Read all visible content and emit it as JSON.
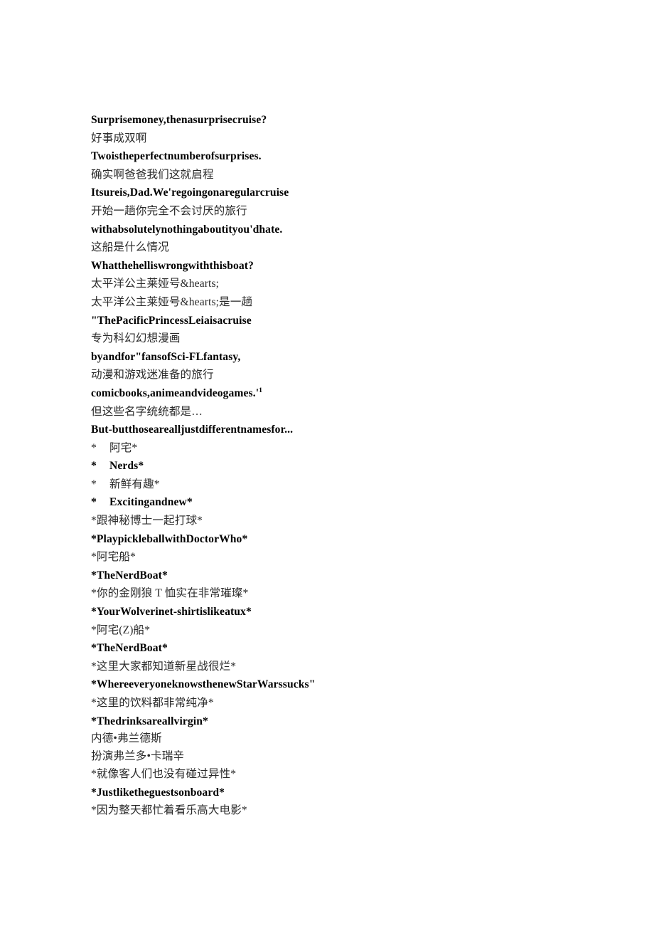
{
  "document": {
    "background_color": "#ffffff",
    "text_color": "#111111",
    "lines": [
      {
        "id": "l1",
        "text": "Surprisemoney,thenasurprisecruise?",
        "script": "latin",
        "style": "plain"
      },
      {
        "id": "l2",
        "text": "好事成双啊",
        "script": "cjk",
        "style": "plain"
      },
      {
        "id": "l3",
        "text": "Twoistheperfectnumberofsurprises.",
        "script": "latin",
        "style": "plain"
      },
      {
        "id": "l4",
        "text": "确实啊爸爸我们这就启程",
        "script": "cjk",
        "style": "plain"
      },
      {
        "id": "l5",
        "text": "Itsureis,Dad.We'regoingonaregularcruise",
        "script": "latin",
        "style": "plain"
      },
      {
        "id": "l6",
        "text": "开始一趟你完全不会讨厌的旅行",
        "script": "cjk",
        "style": "plain"
      },
      {
        "id": "l7",
        "text": "withabsolutelynothingaboutityou'dhate.",
        "script": "latin",
        "style": "plain"
      },
      {
        "id": "l8",
        "text": "这船是什么情况",
        "script": "cjk",
        "style": "plain"
      },
      {
        "id": "l9",
        "text": "Whatthehelliswrongwiththisboat?",
        "script": "latin",
        "style": "plain"
      },
      {
        "id": "l10",
        "text": "太平洋公主莱娅号&hearts;",
        "script": "cjk",
        "style": "plain"
      },
      {
        "id": "l11",
        "text": "太平洋公主莱娅号&hearts;是一趟",
        "script": "cjk",
        "style": "plain"
      },
      {
        "id": "l12",
        "text": "\"ThePacificPrincessLeiaisacruise",
        "script": "latin",
        "style": "plain"
      },
      {
        "id": "l13",
        "text": "专为科幻幻想漫画",
        "script": "cjk",
        "style": "plain"
      },
      {
        "id": "l14",
        "text": "byandfor\"fansofSci-FLfantasy,",
        "script": "latin",
        "style": "plain"
      },
      {
        "id": "l15",
        "text": "动漫和游戏迷准备的旅行",
        "script": "cjk",
        "style": "plain"
      },
      {
        "id": "l16",
        "text": "comicbooks,animeandvideogames.'",
        "script": "latin",
        "style": "footnote",
        "footnote_marker": "1"
      },
      {
        "id": "l17",
        "text": "但这些名字统统都是…",
        "script": "cjk",
        "style": "plain"
      },
      {
        "id": "l18",
        "text": "But-butthosearealljustdifferentnamesfor...",
        "script": "latin",
        "style": "plain"
      },
      {
        "id": "l19",
        "marker": "*",
        "text": "阿宅*",
        "script": "cjk",
        "style": "bullet"
      },
      {
        "id": "l20",
        "marker": "*",
        "text": "Nerds*",
        "script": "latin",
        "style": "bullet"
      },
      {
        "id": "l21",
        "marker": "*",
        "text": "新鲜有趣*",
        "script": "cjk",
        "style": "bullet"
      },
      {
        "id": "l22",
        "marker": "*",
        "text": "Excitingandnew*",
        "script": "latin",
        "style": "bullet"
      },
      {
        "id": "l23",
        "text": "*跟神秘博士一起打球*",
        "script": "cjk",
        "style": "plain"
      },
      {
        "id": "l24",
        "text": "*PlaypickleballwithDoctorWho*",
        "script": "latin",
        "style": "plain"
      },
      {
        "id": "l25",
        "text": "*阿宅船*",
        "script": "cjk",
        "style": "plain"
      },
      {
        "id": "l26",
        "text": "*TheNerdBoat*",
        "script": "latin",
        "style": "plain"
      },
      {
        "id": "l27",
        "text": "*你的金刚狼 T 恤实在非常璀璨*",
        "script": "cjk",
        "style": "plain"
      },
      {
        "id": "l28",
        "text": "*YourWolverinet-shirtislikeatux*",
        "script": "latin",
        "style": "plain"
      },
      {
        "id": "l29",
        "text": "*阿宅(Z)船*",
        "script": "cjk",
        "style": "plain"
      },
      {
        "id": "l30",
        "text": "*TheNerdBoat*",
        "script": "latin",
        "style": "plain"
      },
      {
        "id": "l31",
        "text": "*这里大家都知道新星战很烂*",
        "script": "cjk",
        "style": "plain"
      },
      {
        "id": "l32",
        "text": "*WhereeveryoneknowsthenewStarWarssucks\"",
        "script": "latin",
        "style": "plain"
      },
      {
        "id": "l33",
        "text": "*这里的饮料都非常纯净*",
        "script": "cjk",
        "style": "plain"
      },
      {
        "id": "l34",
        "text": "*Thedrinksareallvirgin*",
        "script": "latin",
        "style": "plain"
      },
      {
        "id": "l35",
        "text": "内德•弗兰德斯",
        "script": "cjk",
        "style": "tight"
      },
      {
        "id": "l36",
        "text": "扮演弗兰多•卡瑞辛",
        "script": "cjk",
        "style": "tight"
      },
      {
        "id": "l37",
        "text": "*就像客人们也没有碰过异性*",
        "script": "cjk",
        "style": "plain"
      },
      {
        "id": "l38",
        "text": "*Justliketheguestsonboard*",
        "script": "latin",
        "style": "plain"
      },
      {
        "id": "l39",
        "text": "*因为整天都忙着看乐高大电影*",
        "script": "cjk",
        "style": "plain"
      }
    ]
  }
}
